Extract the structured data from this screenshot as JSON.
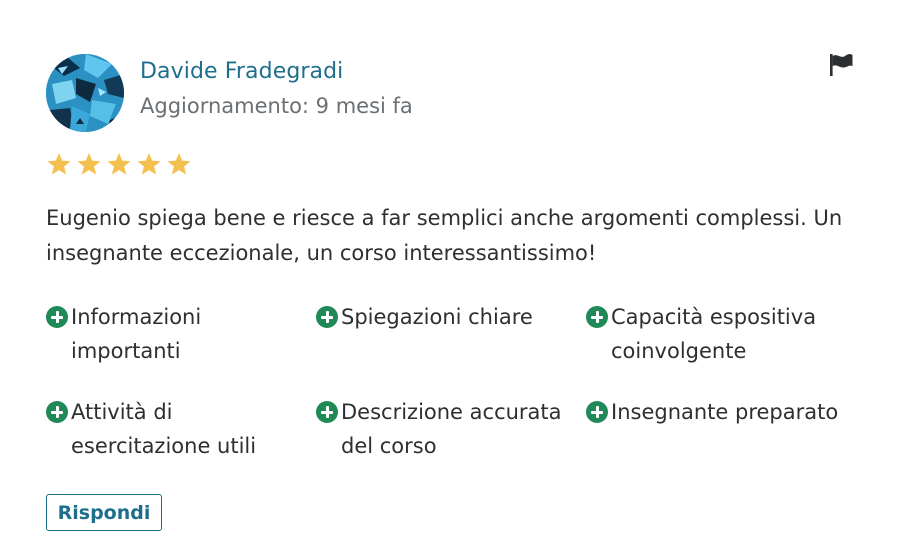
{
  "review": {
    "author_name": "Davide Fradegradi",
    "updated": "Aggiornamento: 9 mesi fa",
    "rating": 5,
    "rating_max": 5,
    "text": "Eugenio spiega bene e riesce a far semplici anche argomenti complessi. Un insegnante eccezionale, un corso interessantissimo!",
    "tags": [
      "Informazioni importanti",
      "Spiegazioni chiare",
      "Capacità espositiva coinvolgente",
      "Attività di esercitazione utili",
      "Descrizione accurata del corso",
      "Insegnante preparato"
    ],
    "reply_label": "Rispondi"
  },
  "icons": {
    "report": "flag-icon",
    "tag": "plus-circle-icon",
    "star": "star-icon"
  },
  "colors": {
    "accent": "#1e6f8c",
    "star": "#f4c150",
    "tag_icon": "#1f8a57",
    "muted_text": "#6a6f73"
  }
}
